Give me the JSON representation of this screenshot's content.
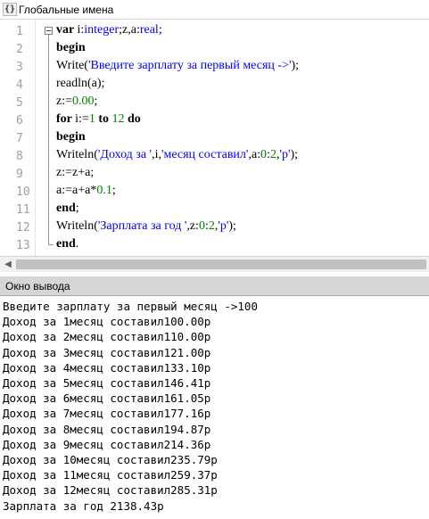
{
  "window": {
    "title": "Глобальные имена",
    "icon": "braces-icon"
  },
  "editor": {
    "line_numbers": [
      "1",
      "2",
      "3",
      "4",
      "5",
      "6",
      "7",
      "8",
      "9",
      "10",
      "11",
      "12",
      "13"
    ],
    "lines": [
      [
        {
          "t": "var ",
          "c": "kw"
        },
        {
          "t": "i:",
          "c": ""
        },
        {
          "t": "integer",
          "c": "ty"
        },
        {
          "t": ";z,a:",
          "c": ""
        },
        {
          "t": "real",
          "c": "ty"
        },
        {
          "t": ";",
          "c": ""
        }
      ],
      [
        {
          "t": "begin",
          "c": "kw"
        }
      ],
      [
        {
          "t": "Write(",
          "c": ""
        },
        {
          "t": "'Введите зарплату за первый месяц ->'",
          "c": "str"
        },
        {
          "t": ");",
          "c": ""
        }
      ],
      [
        {
          "t": "readln(a);",
          "c": ""
        }
      ],
      [
        {
          "t": "z:=",
          "c": ""
        },
        {
          "t": "0.00",
          "c": "num"
        },
        {
          "t": ";",
          "c": ""
        }
      ],
      [
        {
          "t": "for ",
          "c": "kw"
        },
        {
          "t": "i:=",
          "c": ""
        },
        {
          "t": "1",
          "c": "num"
        },
        {
          "t": " ",
          "c": ""
        },
        {
          "t": "to",
          "c": "kw"
        },
        {
          "t": " ",
          "c": ""
        },
        {
          "t": "12",
          "c": "num"
        },
        {
          "t": " ",
          "c": ""
        },
        {
          "t": "do",
          "c": "kw"
        }
      ],
      [
        {
          "t": "begin",
          "c": "kw"
        }
      ],
      [
        {
          "t": "Writeln(",
          "c": ""
        },
        {
          "t": "'Доход за '",
          "c": "str"
        },
        {
          "t": ",i,",
          "c": ""
        },
        {
          "t": "'месяц составил'",
          "c": "str"
        },
        {
          "t": ",a:",
          "c": ""
        },
        {
          "t": "0",
          "c": "num"
        },
        {
          "t": ":",
          "c": ""
        },
        {
          "t": "2",
          "c": "num"
        },
        {
          "t": ",",
          "c": ""
        },
        {
          "t": "'р'",
          "c": "str"
        },
        {
          "t": ");",
          "c": ""
        }
      ],
      [
        {
          "t": "z:=z+a;",
          "c": ""
        }
      ],
      [
        {
          "t": "a:=a+a*",
          "c": ""
        },
        {
          "t": "0.1",
          "c": "num"
        },
        {
          "t": ";",
          "c": ""
        }
      ],
      [
        {
          "t": "end",
          "c": "kw"
        },
        {
          "t": ";",
          "c": ""
        }
      ],
      [
        {
          "t": "Writeln(",
          "c": ""
        },
        {
          "t": "'Зарплата за год '",
          "c": "str"
        },
        {
          "t": ",z:",
          "c": ""
        },
        {
          "t": "0",
          "c": "num"
        },
        {
          "t": ":",
          "c": ""
        },
        {
          "t": "2",
          "c": "num"
        },
        {
          "t": ",",
          "c": ""
        },
        {
          "t": "'р'",
          "c": "str"
        },
        {
          "t": ");",
          "c": ""
        }
      ],
      [
        {
          "t": "end",
          "c": "kw"
        },
        {
          "t": ".",
          "c": ""
        }
      ]
    ]
  },
  "output_panel": {
    "title": "Окно вывода",
    "lines": [
      "Введите зарплату за первый месяц ->100",
      "Доход за 1месяц составил100.00р",
      "Доход за 2месяц составил110.00р",
      "Доход за 3месяц составил121.00р",
      "Доход за 4месяц составил133.10р",
      "Доход за 5месяц составил146.41р",
      "Доход за 6месяц составил161.05р",
      "Доход за 7месяц составил177.16р",
      "Доход за 8месяц составил194.87р",
      "Доход за 9месяц составил214.36р",
      "Доход за 10месяц составил235.79р",
      "Доход за 11месяц составил259.37р",
      "Доход за 12месяц составил285.31р",
      "Зарплата за год 2138.43р"
    ]
  },
  "colors": {
    "keyword": "#000000",
    "type": "#0000ff",
    "string": "#0000ff",
    "number": "#008000",
    "line_number": "#a0a0a0"
  }
}
